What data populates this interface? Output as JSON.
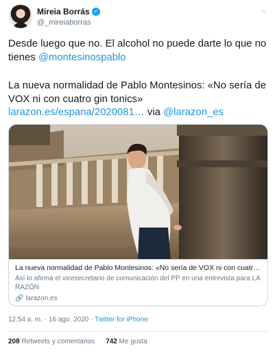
{
  "author": {
    "name": "Mireia Borrás",
    "handle": "@_mireiaborras"
  },
  "tweet": {
    "line1_text": "Desde luego que no. El alcohol no puede darte lo que no tienes ",
    "line1_mention": "@montesinospablo",
    "line2_text": "La nueva normalidad de Pablo Montesinos: «No sería de VOX ni con cuatro gin tonics» ",
    "line2_link": "larazon.es/espana/2020081…",
    "line2_via": " via ",
    "line2_via_mention": "@larazon_es"
  },
  "card": {
    "title": "La nueva normalidad de Pablo Montesinos: «No sería de VOX ni con cuatro gi...",
    "description": "Así lo afirma el vicesecretario de comunicación del PP en una entrevista para LA RAZÓN",
    "domain": "larazon.es"
  },
  "footer": {
    "time": "12:54 a. m.",
    "separator": " · ",
    "date": "16 ago. 2020",
    "source": "Twitter for iPhone",
    "retweets_count": "208",
    "retweets_label": "Retweets y comentarios",
    "likes_count": "742",
    "likes_label": "Me gusta"
  },
  "icons": {
    "verified": "verified-badge-icon",
    "caret": "chevron-down-icon",
    "link": "link-icon"
  },
  "colors": {
    "accent": "#1da1f2",
    "link": "#1b95e0",
    "secondary_text": "#657786"
  }
}
